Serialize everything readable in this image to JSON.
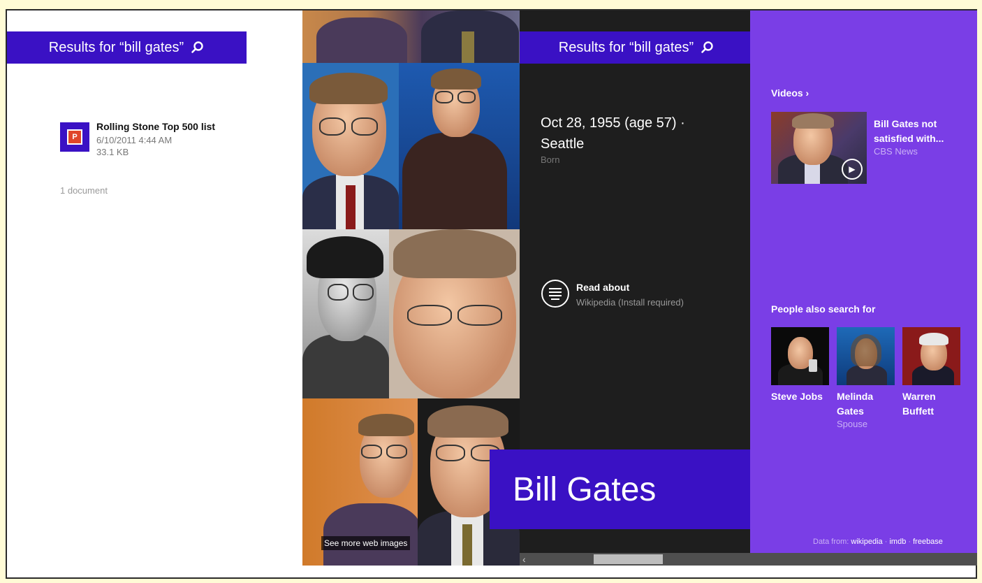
{
  "left_panel": {
    "search_banner": "Results for “bill gates”",
    "document": {
      "title": "Rolling Stone Top 500 list",
      "date": "6/10/2011 4:44 AM",
      "size": "33.1 KB",
      "icon": "powerpoint-icon",
      "icon_glyph": "P"
    },
    "count": "1 document"
  },
  "images_panel": {
    "see_more": "See more web images"
  },
  "info_panel": {
    "search_banner": "Results for “bill gates”",
    "born_value": "Oct 28, 1955 (age 57) · Seattle",
    "born_label": "Born",
    "read_about_title": "Read about",
    "read_about_sub": "Wikipedia (Install required)",
    "name": "Bill Gates"
  },
  "purple_panel": {
    "videos_heading": "Videos ›",
    "video": {
      "title": "Bill Gates not satisfied with...",
      "source": "CBS News"
    },
    "people_heading": "People also search for",
    "people": [
      {
        "name": "Steve Jobs",
        "sub": ""
      },
      {
        "name": "Melinda Gates",
        "sub": "Spouse"
      },
      {
        "name": "Warren Buffett",
        "sub": ""
      }
    ],
    "data_from_label": "Data from:",
    "sources": [
      "wikipedia",
      "imdb",
      "freebase"
    ],
    "separator": "·"
  },
  "colors": {
    "banner": "#3a11c4",
    "purple": "#7a3ee6",
    "dark": "#1e1e1e",
    "background": "#fffbd6"
  }
}
